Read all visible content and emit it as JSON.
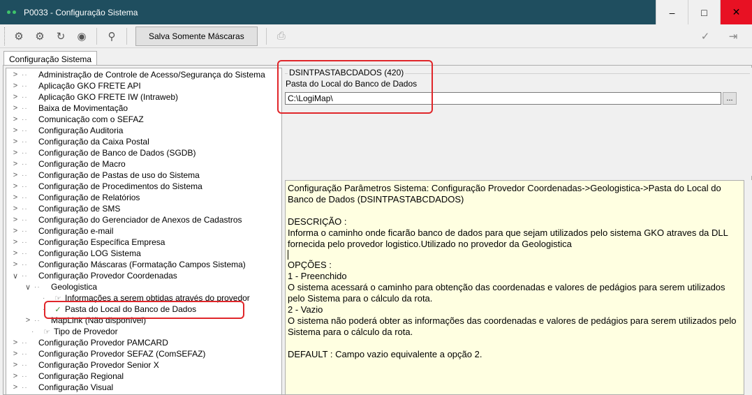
{
  "window": {
    "title": "P0033 - Configuração Sistema",
    "minimize_icon": "minimize-icon",
    "maximize_icon": "maximize-icon",
    "close_icon": "close-icon"
  },
  "toolbar": {
    "save_masks_label": "Salva Somente Máscaras"
  },
  "tabs": [
    {
      "label": "Configuração Sistema"
    }
  ],
  "tree": {
    "items": [
      {
        "label": "Administração de Controle de Acesso/Segurança do Sistema"
      },
      {
        "label": "Aplicação GKO FRETE API"
      },
      {
        "label": "Aplicação GKO FRETE IW (Intraweb)"
      },
      {
        "label": "Baixa de Movimentação"
      },
      {
        "label": "Comunicação com o SEFAZ"
      },
      {
        "label": "Configuração Auditoria"
      },
      {
        "label": "Configuração da Caixa Postal"
      },
      {
        "label": "Configuração de Banco de Dados (SGDB)"
      },
      {
        "label": "Configuração de Macro"
      },
      {
        "label": "Configuração de Pastas de uso do Sistema"
      },
      {
        "label": "Configuração de Procedimentos do Sistema"
      },
      {
        "label": "Configuração de Relatórios"
      },
      {
        "label": "Configuração de SMS"
      },
      {
        "label": "Configuração do Gerenciador de Anexos de Cadastros"
      },
      {
        "label": "Configuração e-mail"
      },
      {
        "label": "Configuração Específica Empresa"
      },
      {
        "label": "Configuração LOG Sistema"
      },
      {
        "label": "Configuração Máscaras (Formatação Campos Sistema)"
      },
      {
        "label": "Configuração Provedor Coordenadas"
      },
      {
        "label": "Geologistica"
      },
      {
        "label": "Informações a serem obtidas através do provedor"
      },
      {
        "label": "Pasta do Local do Banco de Dados"
      },
      {
        "label": "MapLink (Não disponível)"
      },
      {
        "label": "Tipo de Provedor"
      },
      {
        "label": "Configuração Provedor PAMCARD"
      },
      {
        "label": "Configuração Provedor SEFAZ (ComSEFAZ)"
      },
      {
        "label": "Configuração Provedor Senior X"
      },
      {
        "label": "Configuração Regional"
      },
      {
        "label": "Configuração Visual"
      }
    ]
  },
  "parameter": {
    "group_title": "DSINTPASTABCDADOS (420)",
    "field_label": "Pasta do Local do Banco de Dados",
    "field_value": "C:\\LogiMap\\",
    "browse_label": "..."
  },
  "description": {
    "line1": "Configuração Parâmetros Sistema: Configuração Provedor Coordenadas->Geologistica->Pasta do Local do Banco de Dados (DSINTPASTABCDADOS)",
    "desc_heading": "DESCRIÇÃO :",
    "desc_text": "Informa o caminho onde ficarão banco de dados para que sejam utilizados pelo sistema GKO atraves da DLL fornecida pelo provedor logistico.Utilizado no provedor da Geologistica",
    "options_heading": "OPÇÕES :",
    "opt1_title": "1 - Preenchido",
    "opt1_text": "O sistema acessará o caminho para obtenção das coordenadas e valores de pedágios para serem utilizados pelo Sistema para o cálculo da rota.",
    "opt2_title": "2 - Vazio",
    "opt2_text": "O sistema não poderá obter as informações das coordenadas e valores de pedágios para serem utilizados pelo Sistema para o cálculo da rota.",
    "default_text": "DEFAULT : Campo vazio equivalente a opção 2."
  },
  "colors": {
    "titlebar": "#1f4e5f",
    "description_bg": "#ffffe1",
    "highlight": "#e0262a"
  }
}
